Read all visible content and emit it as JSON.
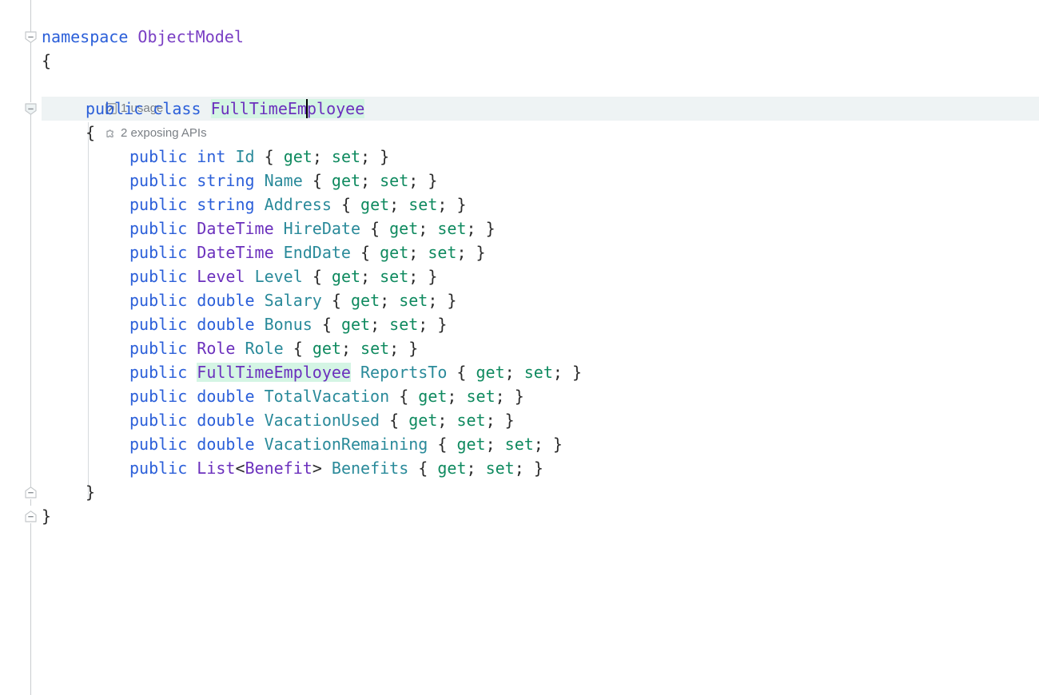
{
  "editor": {
    "language": "csharp",
    "font_size_px": 20,
    "line_height_px": 30,
    "colors": {
      "background": "#ffffff",
      "current_line": "#eef3f4",
      "symbol_highlight": "#d4f5e4",
      "keyword": "#2b5fd9",
      "namespace_name": "#7a3fc4",
      "user_type": "#6b30bd",
      "property_name": "#2a8a9a",
      "accessor": "#0f8a5f",
      "punctuation": "#2b2b2b",
      "gutter_line": "#c9cdd0",
      "indent_guide": "#d7dadd",
      "hint_text": "#7a7f85",
      "caret": "#000000"
    }
  },
  "codelens": {
    "hints": [
      {
        "icon": "usage-arrow-icon",
        "label": "1 usage"
      },
      {
        "icon": "exposing-api-puzzle-icon",
        "label": "2 exposing APIs"
      }
    ]
  },
  "caret": {
    "line": "public class FullTimeEmployee",
    "before_text": "FullTimeEm",
    "after_text": "ployee"
  },
  "code": {
    "namespace_keyword": "namespace",
    "namespace_name": "ObjectModel",
    "open_brace": "{",
    "close_brace": "}",
    "class_modifier": "public",
    "class_keyword": "class",
    "class_name": "FullTimeEmployee",
    "accessor_open": "{",
    "accessor_get": "get",
    "accessor_set": "set",
    "semicolon": ";",
    "accessor_close": "}",
    "members": [
      {
        "modifier": "public",
        "type": "int",
        "type_kind": "kw",
        "name": "Id"
      },
      {
        "modifier": "public",
        "type": "string",
        "type_kind": "kw",
        "name": "Name"
      },
      {
        "modifier": "public",
        "type": "string",
        "type_kind": "kw",
        "name": "Address"
      },
      {
        "modifier": "public",
        "type": "DateTime",
        "type_kind": "utype",
        "name": "HireDate"
      },
      {
        "modifier": "public",
        "type": "DateTime",
        "type_kind": "utype",
        "name": "EndDate"
      },
      {
        "modifier": "public",
        "type": "Level",
        "type_kind": "utype",
        "name": "Level"
      },
      {
        "modifier": "public",
        "type": "double",
        "type_kind": "kw",
        "name": "Salary"
      },
      {
        "modifier": "public",
        "type": "double",
        "type_kind": "kw",
        "name": "Bonus"
      },
      {
        "modifier": "public",
        "type": "Role",
        "type_kind": "utype",
        "name": "Role"
      },
      {
        "modifier": "public",
        "type": "FullTimeEmployee",
        "type_kind": "utype",
        "name": "ReportsTo",
        "highlighted": true
      },
      {
        "modifier": "public",
        "type": "double",
        "type_kind": "kw",
        "name": "TotalVacation"
      },
      {
        "modifier": "public",
        "type": "double",
        "type_kind": "kw",
        "name": "VacationUsed"
      },
      {
        "modifier": "public",
        "type": "double",
        "type_kind": "kw",
        "name": "VacationRemaining"
      },
      {
        "modifier": "public",
        "type": "List<Benefit>",
        "type_kind": "generic",
        "generic_outer": "List",
        "generic_inner": "Benefit",
        "name": "Benefits"
      }
    ]
  },
  "gutter": {
    "fold_markers": [
      {
        "kind": "expanded-open",
        "for": "namespace ObjectModel"
      },
      {
        "kind": "expanded-open",
        "for": "class FullTimeEmployee"
      },
      {
        "kind": "expanded-close",
        "for": "class FullTimeEmployee"
      },
      {
        "kind": "expanded-close",
        "for": "namespace ObjectModel"
      }
    ]
  }
}
